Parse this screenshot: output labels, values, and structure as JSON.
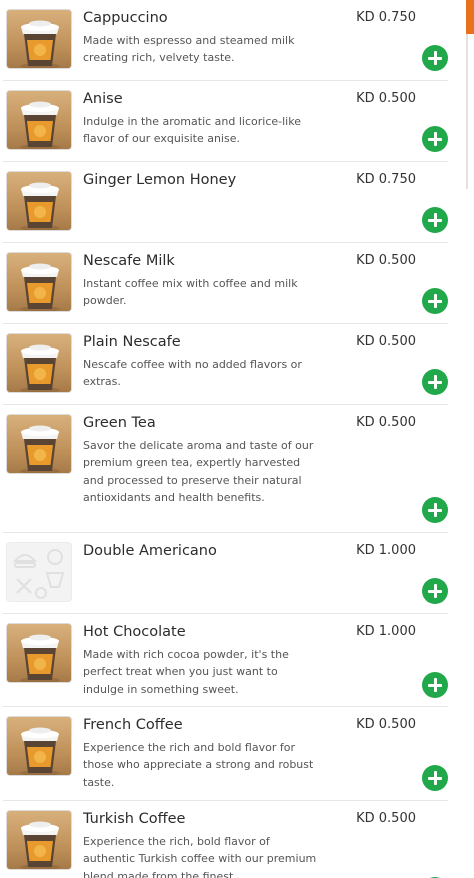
{
  "currency_prefix": "KD",
  "colors": {
    "add_button": "#21a84b",
    "accent": "#e8711c"
  },
  "items": [
    {
      "name": "Cappuccino",
      "price": "KD 0.750",
      "description": "Made with espresso and steamed milk creating rich, velvety taste.",
      "image": "coffee-cup"
    },
    {
      "name": "Anise",
      "price": "KD 0.500",
      "description": "Indulge in the aromatic and licorice-like flavor of our exquisite anise.",
      "image": "coffee-cup"
    },
    {
      "name": "Ginger Lemon Honey",
      "price": "KD 0.750",
      "description": "",
      "image": "coffee-cup"
    },
    {
      "name": "Nescafe Milk",
      "price": "KD 0.500",
      "description": "Instant coffee mix with coffee and milk powder.",
      "image": "coffee-cup"
    },
    {
      "name": "Plain Nescafe",
      "price": "KD 0.500",
      "description": "Nescafe coffee with no added flavors or extras.",
      "image": "coffee-cup"
    },
    {
      "name": "Green Tea",
      "price": "KD 0.500",
      "description": "Savor the delicate aroma and taste of our premium green tea, expertly harvested and processed to preserve their natural antioxidants and health benefits.",
      "image": "coffee-cup"
    },
    {
      "name": "Double Americano",
      "price": "KD 1.000",
      "description": "",
      "image": "placeholder-food"
    },
    {
      "name": "Hot Chocolate",
      "price": "KD 1.000",
      "description": "Made with rich cocoa powder, it's the perfect treat when you just want to indulge in something sweet.",
      "image": "coffee-cup"
    },
    {
      "name": "French Coffee",
      "price": "KD 0.500",
      "description": "Experience the rich and bold flavor for those who appreciate a strong and robust taste.",
      "image": "coffee-cup"
    },
    {
      "name": "Turkish Coffee",
      "price": "KD 0.500",
      "description": "Experience the rich, bold flavor of authentic Turkish coffee with our premium blend made from the finest",
      "image": "coffee-cup"
    }
  ]
}
